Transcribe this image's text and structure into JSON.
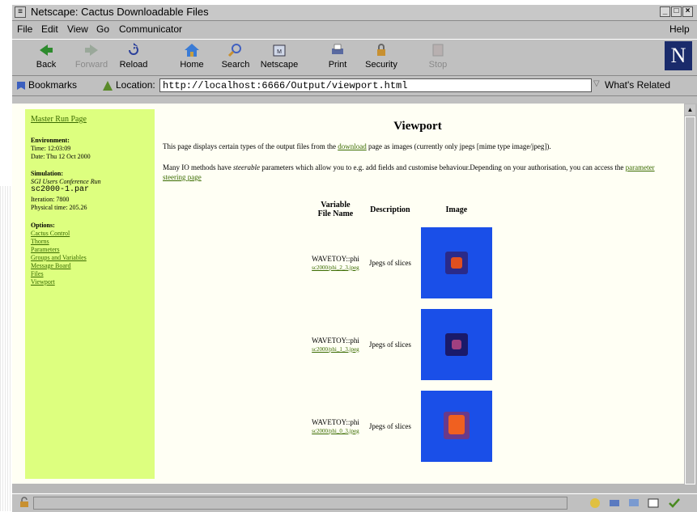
{
  "window": {
    "title": "Netscape: Cactus Downloadable Files"
  },
  "menu": [
    "File",
    "Edit",
    "View",
    "Go",
    "Communicator",
    "Help"
  ],
  "toolbar": {
    "back": "Back",
    "forward": "Forward",
    "reload": "Reload",
    "home": "Home",
    "search": "Search",
    "netscape": "Netscape",
    "print": "Print",
    "security": "Security",
    "stop": "Stop",
    "logo": "N"
  },
  "location": {
    "bookmarks": "Bookmarks",
    "label": "Location:",
    "url": "http://localhost:6666/Output/viewport.html",
    "related": "What's Related"
  },
  "sidebar": {
    "master": "Master Run Page",
    "env_heading": "Environment:",
    "time": "Time: 12:03:09",
    "date": "Date: Thu 12 Oct 2000",
    "sim_heading": "Simulation:",
    "sim_name": "SGI Users Conference Run",
    "parfile": "sc2000-1.par",
    "iteration": "Iteration: 7800",
    "physical_time": "Physical time: 205.26",
    "opt_heading": "Options:",
    "options": [
      "Cactus Control",
      "Thorns",
      "Parameters",
      "Groups and Variables",
      "Message Board",
      "Files",
      "Viewport"
    ]
  },
  "main": {
    "title": "Viewport",
    "p1_a": "This page displays certain types of the output files from the ",
    "p1_link": "download",
    "p1_b": " page as images (currently only jpegs [mime type image/jpeg]).",
    "p2_a": "Many IO methods have ",
    "p2_em": "steerable",
    "p2_b": " parameters which allow you to e.g. add fields and customise behaviour.Depending on your authorisation, you can access the ",
    "p2_link": "parameter steering page",
    "col_var": "Variable",
    "col_file": "File Name",
    "col_desc": "Description",
    "col_img": "Image",
    "rows": [
      {
        "var": "WAVETOY::phi",
        "file": "sc2000/phi_2_3.jpeg",
        "desc": "Jpegs of slices"
      },
      {
        "var": "WAVETOY::phi",
        "file": "sc2000/phi_1_3.jpeg",
        "desc": "Jpegs of slices"
      },
      {
        "var": "WAVETOY::phi",
        "file": "sc2000/phi_0_3.jpeg",
        "desc": "Jpegs of slices"
      }
    ]
  },
  "colors": {
    "sidebar": "#ddff7f",
    "link": "#3a6b00",
    "page_bg": "#fffff4",
    "image_blue": "#1a4fe8"
  }
}
